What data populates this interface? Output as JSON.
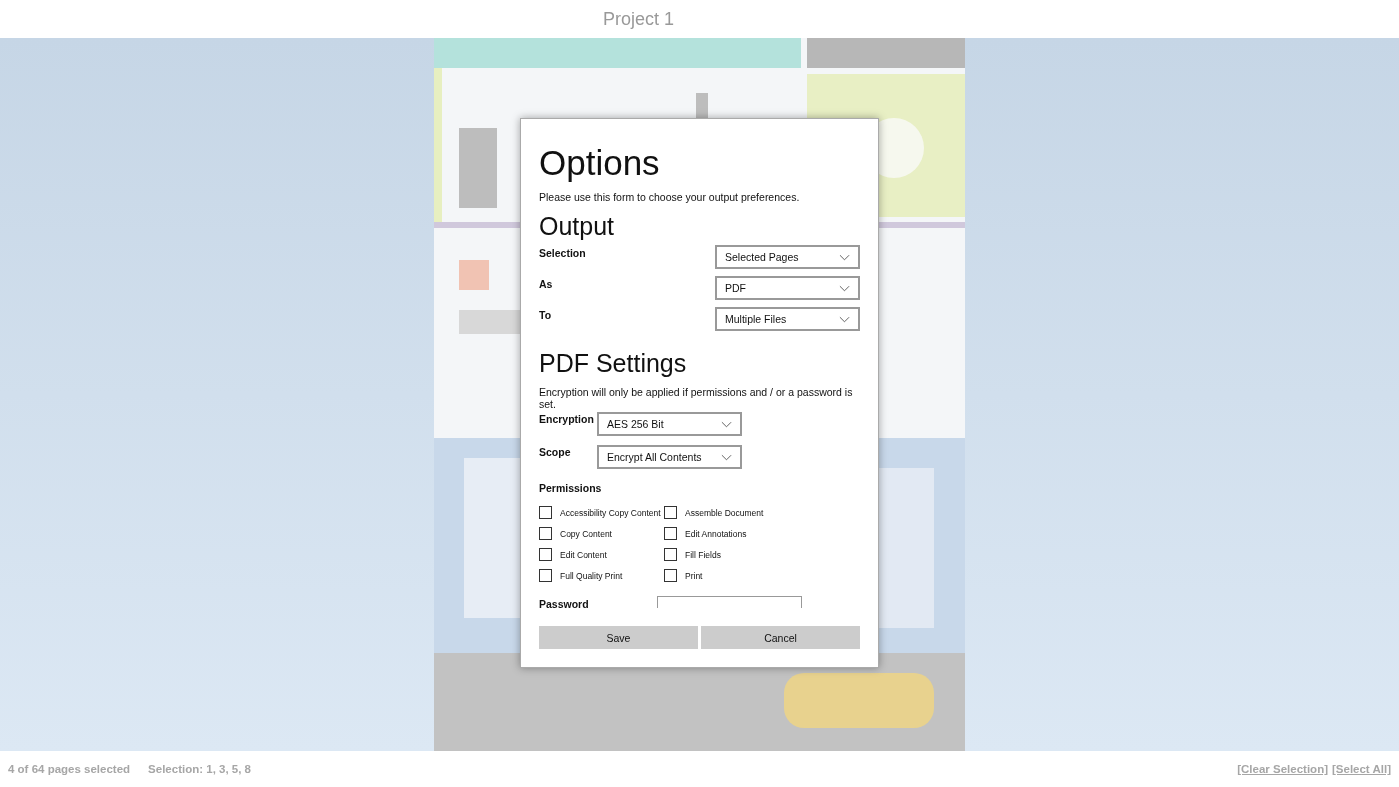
{
  "header": {
    "title": "Project 1"
  },
  "dialog": {
    "title": "Options",
    "intro": "Please use this form to choose your output preferences.",
    "output": {
      "heading": "Output",
      "fields": [
        {
          "label": "Selection",
          "value": "Selected Pages"
        },
        {
          "label": "As",
          "value": "PDF"
        },
        {
          "label": "To",
          "value": "Multiple Files"
        }
      ]
    },
    "pdf_settings": {
      "heading": "PDF Settings",
      "note": "Encryption will only be applied if permissions and / or a password is set.",
      "fields": [
        {
          "label": "Encryption",
          "value": "AES 256 Bit"
        },
        {
          "label": "Scope",
          "value": "Encrypt All Contents"
        }
      ],
      "permissions_label": "Permissions",
      "permissions": [
        {
          "label": "Accessibility Copy Content",
          "checked": false
        },
        {
          "label": "Assemble Document",
          "checked": false
        },
        {
          "label": "Copy Content",
          "checked": false
        },
        {
          "label": "Edit Annotations",
          "checked": false
        },
        {
          "label": "Edit Content",
          "checked": false
        },
        {
          "label": "Fill Fields",
          "checked": false
        },
        {
          "label": "Full Quality Print",
          "checked": false
        },
        {
          "label": "Print",
          "checked": false
        }
      ],
      "password_label": "Password"
    },
    "buttons": [
      "Save",
      "Cancel"
    ]
  },
  "status_bar": {
    "count": "4 of 64 pages selected",
    "selection": "Selection: 1, 3, 5, 8",
    "links": [
      "[Clear Selection]",
      "[Select All]"
    ]
  }
}
